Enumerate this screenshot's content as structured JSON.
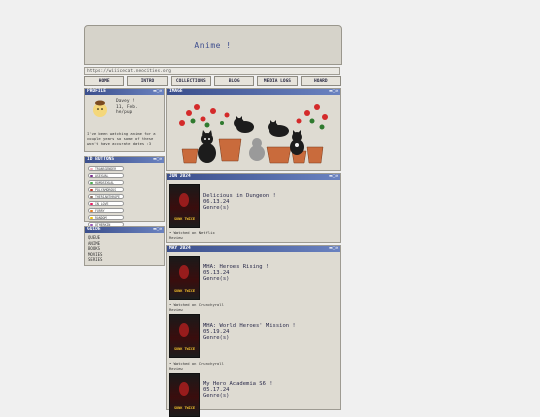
{
  "header": {
    "title": "Anime !"
  },
  "url": "https://wiiicecat.neocities.org",
  "nav": [
    "HOME",
    "INTRO",
    "COLLECTIONS",
    "BLOG",
    "MEDIA LOGS",
    "HOARD"
  ],
  "profile": {
    "title": "PROFILE",
    "name": "Davey !",
    "birthday": "11, Feb.",
    "pronouns": "he/pup",
    "bio": "I've been watching anime for a couple years so some of these won't have accurate dates :3"
  },
  "id_buttons": {
    "title": "ID BUTTONS",
    "badges": [
      {
        "label": "TRANSGENDER",
        "color": "#f5a9b8"
      },
      {
        "label": "ASEXUAL",
        "color": "#7b2d8f"
      },
      {
        "label": "HOMOSEXUAL",
        "color": "#4caf50"
      },
      {
        "label": "POLYAMOROUS",
        "color": "#c0392b"
      },
      {
        "label": "THERIANTHROPE",
        "color": "#8d6e63"
      },
      {
        "label": "IN LOVE",
        "color": "#e91e63"
      },
      {
        "label": "FURRY",
        "color": "#e67e22"
      },
      {
        "label": "RANDOM",
        "color": "#f1c40f"
      },
      {
        "label": "OTHERKIN",
        "color": "#9b59b6"
      },
      {
        "label": "STARWORTH",
        "color": "#16a085"
      },
      {
        "label": "AUTISTIC",
        "color": "#2980b9"
      },
      {
        "label": "ADHD",
        "color": "#27ae60"
      },
      {
        "label": "DEPRESSION",
        "color": "#34495e"
      },
      {
        "label": "PSYCHO",
        "color": "#7f8c8d"
      }
    ]
  },
  "guide": {
    "title": "GUIDE",
    "items": [
      "QUEUE",
      "ANIME",
      "BOOKS",
      "MOVIES",
      "SERIES"
    ]
  },
  "image_panel": {
    "title": "IMAGE"
  },
  "june": {
    "title": "JUN 2024",
    "entries": [
      {
        "title": "Delicious in Dungeon !",
        "date": "06.13.24",
        "genre": "Genre(s)",
        "poster": "SUNK TWICE",
        "watched": "Watched on Netflix",
        "review": "Review"
      }
    ]
  },
  "may": {
    "title": "MAY 2024",
    "entries": [
      {
        "title": "MHA: Heroes Rising !",
        "date": "05.13.24",
        "genre": "Genre(s)",
        "poster": "SUNK TWICE",
        "watched": "Watched on Crunchyroll",
        "review": "Review"
      },
      {
        "title": "MHA: World Heroes' Mission !",
        "date": "05.19.24",
        "genre": "Genre(s)",
        "poster": "SUNK TWICE",
        "watched": "Watched on Crunchyroll",
        "review": "Review"
      },
      {
        "title": "My Hero Academia S6 !",
        "date": "05.17.24",
        "genre": "Genre(s)",
        "poster": "SUNK TWICE"
      }
    ]
  },
  "colors": {
    "titlebar": "#3b4f8c",
    "panel": "#dedbd2",
    "header_text": "#3f4f8f"
  }
}
